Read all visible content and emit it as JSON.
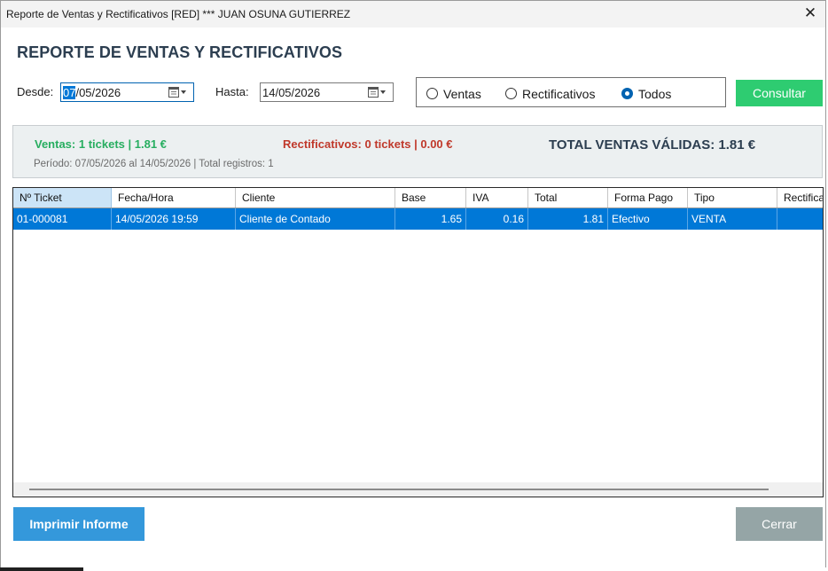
{
  "window": {
    "title": "Reporte de Ventas y Rectificativos [RED] *** JUAN OSUNA GUTIERREZ",
    "close_glyph": "✕"
  },
  "heading": "REPORTE DE VENTAS Y RECTIFICATIVOS",
  "filters": {
    "desde_label": "Desde:",
    "desde_selected": "07",
    "desde_rest": "/05/2026",
    "hasta_label": "Hasta:",
    "hasta_value": "14/05/2026",
    "radios": [
      {
        "label": "Ventas",
        "checked": false
      },
      {
        "label": "Rectificativos",
        "checked": false
      },
      {
        "label": "Todos",
        "checked": true
      }
    ],
    "consultar_label": "Consultar"
  },
  "summary": {
    "ventas": "Ventas: 1 tickets | 1.81 €",
    "rectificativos": "Rectificativos: 0 tickets | 0.00 €",
    "total": "TOTAL VENTAS VÁLIDAS: 1.81 €",
    "periodo": "Período: 07/05/2026 al 14/05/2026 | Total registros: 1"
  },
  "table": {
    "columns": [
      "Nº Ticket",
      "Fecha/Hora",
      "Cliente",
      "Base",
      "IVA",
      "Total",
      "Forma Pago",
      "Tipo",
      "Rectifica"
    ],
    "rows": [
      [
        "01-000081",
        "14/05/2026 19:59",
        "Cliente de Contado",
        "1.65",
        "0.16",
        "1.81",
        "Efectivo",
        "VENTA",
        ""
      ]
    ]
  },
  "buttons": {
    "imprimir": "Imprimir Informe",
    "cerrar": "Cerrar"
  },
  "colors": {
    "accent_green": "#2ecc71",
    "accent_blue": "#3498db",
    "selection": "#0078d7",
    "ventas_text": "#27ae60",
    "rect_text": "#c0392b",
    "heading": "#2c3e50",
    "cerrar": "#95a5a6"
  },
  "icons": {
    "calendar": "calendar-icon",
    "close": "close-icon"
  }
}
